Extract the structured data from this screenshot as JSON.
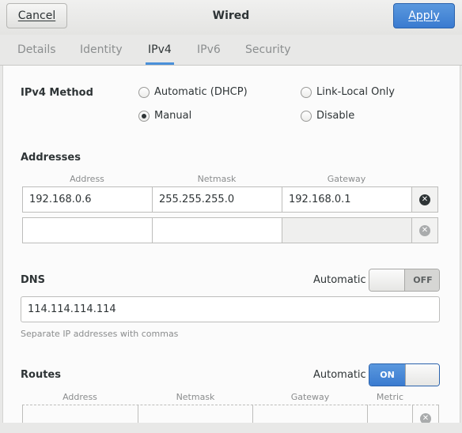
{
  "header": {
    "cancel_label": "Cancel",
    "title": "Wired",
    "apply_label": "Apply"
  },
  "tabs": [
    {
      "label": "Details",
      "active": false
    },
    {
      "label": "Identity",
      "active": false
    },
    {
      "label": "IPv4",
      "active": true
    },
    {
      "label": "IPv6",
      "active": false
    },
    {
      "label": "Security",
      "active": false
    }
  ],
  "ipv4": {
    "method_label": "IPv4 Method",
    "options": [
      {
        "label": "Automatic (DHCP)",
        "selected": false
      },
      {
        "label": "Link-Local Only",
        "selected": false
      },
      {
        "label": "Manual",
        "selected": true
      },
      {
        "label": "Disable",
        "selected": false
      }
    ]
  },
  "addresses": {
    "heading": "Addresses",
    "columns": [
      "Address",
      "Netmask",
      "Gateway"
    ],
    "rows": [
      {
        "address": "192.168.0.6",
        "netmask": "255.255.255.0",
        "gateway": "192.168.0.1"
      },
      {
        "address": "",
        "netmask": "",
        "gateway": ""
      }
    ]
  },
  "dns": {
    "heading": "DNS",
    "automatic_label": "Automatic",
    "switch_state": "OFF",
    "value": "114.114.114.114",
    "hint": "Separate IP addresses with commas"
  },
  "routes": {
    "heading": "Routes",
    "automatic_label": "Automatic",
    "switch_state": "ON",
    "columns": [
      "Address",
      "Netmask",
      "Gateway",
      "Metric"
    ]
  },
  "colors": {
    "accent": "#4a90d9",
    "apply_button": "#3a7bd0",
    "text": "#2e3436"
  },
  "icons": {
    "remove_row": "remove-row-icon"
  }
}
